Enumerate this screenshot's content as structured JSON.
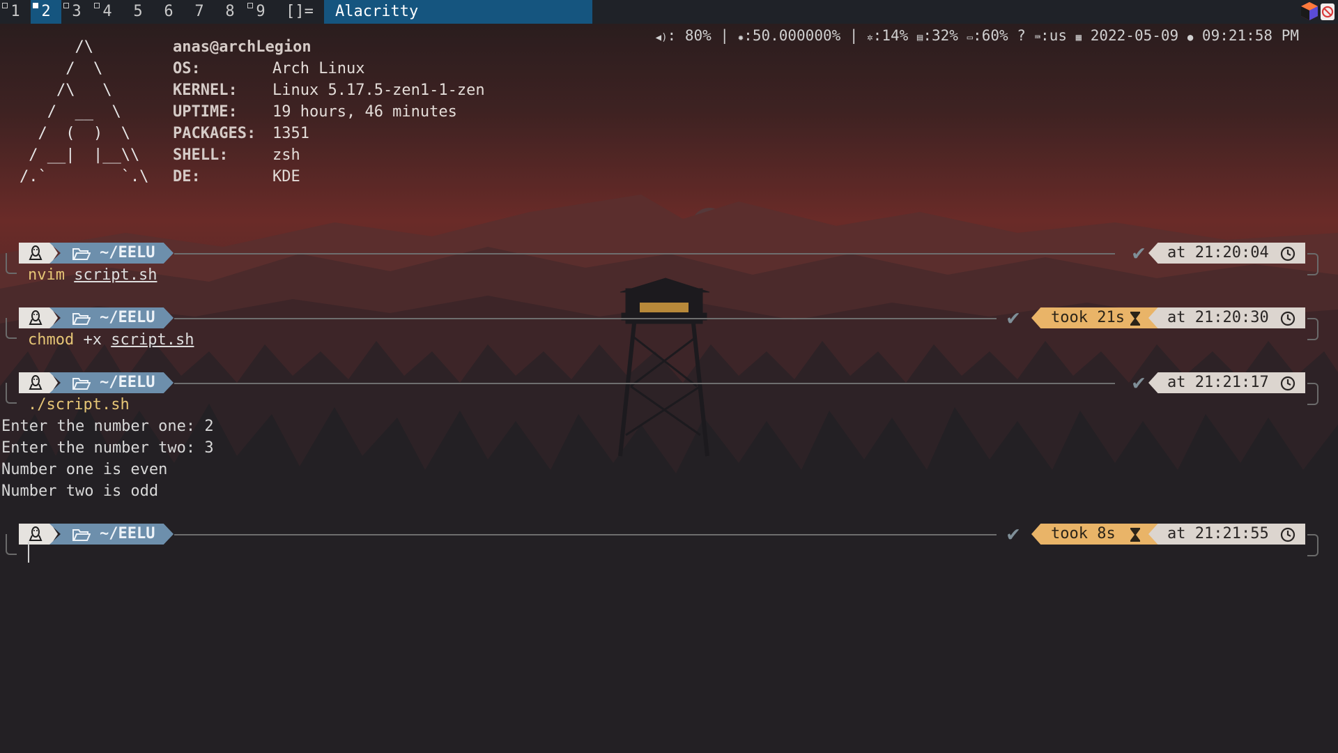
{
  "bar": {
    "workspaces": [
      {
        "label": "1",
        "marked": true,
        "active": false
      },
      {
        "label": "2",
        "marked": true,
        "active": true
      },
      {
        "label": "3",
        "marked": true,
        "active": false
      },
      {
        "label": "4",
        "marked": true,
        "active": false
      },
      {
        "label": "5",
        "marked": false,
        "active": false
      },
      {
        "label": "6",
        "marked": false,
        "active": false
      },
      {
        "label": "7",
        "marked": false,
        "active": false
      },
      {
        "label": "8",
        "marked": false,
        "active": false
      },
      {
        "label": "9",
        "marked": true,
        "active": false
      }
    ],
    "layout": "[]=",
    "window_title": "Alacritty",
    "volume": "80%",
    "brightness": "50.000000%",
    "cpu": "14%",
    "ram": "32%",
    "battery": "60%",
    "battery_extra": "?",
    "keyboard": "us",
    "date": "2022-05-09",
    "time": "09:21:58 PM",
    "sep": "|",
    "accent_color": "#15557f"
  },
  "fetch": {
    "ascii": [
      "      /\\",
      "     /  \\",
      "    /\\   \\",
      "   /  __  \\",
      "  /  (  )  \\",
      " / __|  |__\\\\",
      "/.`        `.\\"
    ],
    "user_host": "anas@archLegion",
    "rows": [
      {
        "label": "OS:",
        "value": "Arch Linux"
      },
      {
        "label": "KERNEL:",
        "value": "Linux 5.17.5-zen1-1-zen"
      },
      {
        "label": "UPTIME:",
        "value": "19 hours, 46 minutes"
      },
      {
        "label": "PACKAGES:",
        "value": "1351"
      },
      {
        "label": "SHELL:",
        "value": "zsh"
      },
      {
        "label": "DE:",
        "value": "KDE"
      }
    ]
  },
  "prompts": [
    {
      "dir": "~/EELU",
      "took": "",
      "at": "at 21:20:04",
      "cmd": "nvim",
      "args": [
        {
          "text": "script.sh",
          "underline": true
        }
      ]
    },
    {
      "dir": "~/EELU",
      "took": "took 21s",
      "at": "at 21:20:30",
      "cmd": "chmod",
      "args": [
        {
          "text": "+x",
          "underline": false
        },
        {
          "text": "script.sh",
          "underline": true
        }
      ]
    },
    {
      "dir": "~/EELU",
      "took": "",
      "at": "at 21:21:17",
      "cmd": "./script.sh",
      "args": []
    },
    {
      "dir": "~/EELU",
      "took": "took 8s",
      "at": "at 21:21:55",
      "cmd": "",
      "args": []
    }
  ],
  "output": [
    "Enter the number one: 2",
    "Enter the number two: 3",
    "Number one is even",
    "Number two is odd"
  ],
  "icons": {
    "os": "linux-penguin-icon",
    "folder": "folder-open-icon",
    "success": "check-icon",
    "duration": "hourglass-icon",
    "clock": "clock-icon"
  },
  "colors": {
    "dir_segment": "#6d8fac",
    "took_segment": "#e9b468",
    "at_segment": "#dcd5cf",
    "command": "#e6c676"
  }
}
